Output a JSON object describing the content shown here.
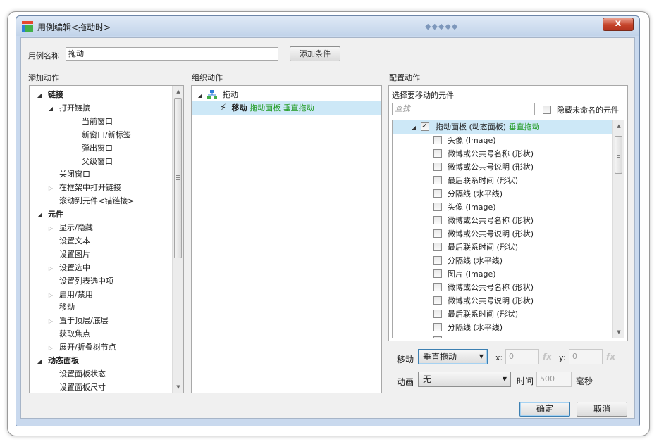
{
  "window": {
    "title": "用例编辑<拖动时>",
    "close_label": "x"
  },
  "case_name": {
    "label": "用例名称",
    "value": "拖动",
    "add_condition": "添加条件"
  },
  "add_actions": {
    "header": "添加动作",
    "items": [
      {
        "label": "链接",
        "level": 0,
        "toggle": "open",
        "bold": true
      },
      {
        "label": "打开链接",
        "level": 1,
        "toggle": "open"
      },
      {
        "label": "当前窗口",
        "level": 2
      },
      {
        "label": "新窗口/新标签",
        "level": 2
      },
      {
        "label": "弹出窗口",
        "level": 2
      },
      {
        "label": "父级窗口",
        "level": 2
      },
      {
        "label": "关闭窗口",
        "level": 1
      },
      {
        "label": "在框架中打开链接",
        "level": 1,
        "toggle": "closed"
      },
      {
        "label": "滚动到元件<锚链接>",
        "level": 1
      },
      {
        "label": "元件",
        "level": 0,
        "toggle": "open",
        "bold": true
      },
      {
        "label": "显示/隐藏",
        "level": 1,
        "toggle": "closed"
      },
      {
        "label": "设置文本",
        "level": 1
      },
      {
        "label": "设置图片",
        "level": 1
      },
      {
        "label": "设置选中",
        "level": 1,
        "toggle": "closed"
      },
      {
        "label": "设置列表选中项",
        "level": 1
      },
      {
        "label": "启用/禁用",
        "level": 1,
        "toggle": "closed"
      },
      {
        "label": "移动",
        "level": 1
      },
      {
        "label": "置于顶层/底层",
        "level": 1,
        "toggle": "closed"
      },
      {
        "label": "获取焦点",
        "level": 1
      },
      {
        "label": "展开/折叠树节点",
        "level": 1,
        "toggle": "closed"
      },
      {
        "label": "动态面板",
        "level": 0,
        "toggle": "open",
        "bold": true
      },
      {
        "label": "设置面板状态",
        "level": 1
      },
      {
        "label": "设置面板尺寸",
        "level": 1
      }
    ]
  },
  "organize_actions": {
    "header": "组织动作",
    "case_label": "拖动",
    "action": {
      "verb": "移动",
      "detail": "拖动面板 垂直拖动"
    }
  },
  "configure_actions": {
    "header": "配置动作",
    "select_label": "选择要移动的元件",
    "search_placeholder": "查找",
    "hide_unnamed_label": "隐藏未命名的元件",
    "root": {
      "label": "拖动面板 (动态面板)",
      "suffix": "垂直拖动"
    },
    "widgets": [
      "头像 (Image)",
      "微博或公共号名称 (形状)",
      "微博或公共号说明 (形状)",
      "最后联系时间 (形状)",
      "分隔线 (水平线)",
      "头像 (Image)",
      "微博或公共号名称 (形状)",
      "微博或公共号说明 (形状)",
      "最后联系时间 (形状)",
      "分隔线 (水平线)",
      "图片 (Image)",
      "微博或公共号名称 (形状)",
      "微博或公共号说明 (形状)",
      "最后联系时间 (形状)",
      "分隔线 (水平线)",
      "(Image)"
    ],
    "move": {
      "label": "移动",
      "value": "垂直拖动",
      "x_label": "x:",
      "x_value": "0",
      "y_label": "y:",
      "y_value": "0",
      "fx": "fx"
    },
    "animate": {
      "label": "动画",
      "value": "无",
      "time_label": "时间",
      "time_value": "500",
      "unit": "毫秒"
    }
  },
  "footer": {
    "ok": "确定",
    "cancel": "取消"
  },
  "colors": {
    "accent_green": "#1f9a1f",
    "selection": "#cde8f7",
    "close_red": "#c5432a"
  }
}
